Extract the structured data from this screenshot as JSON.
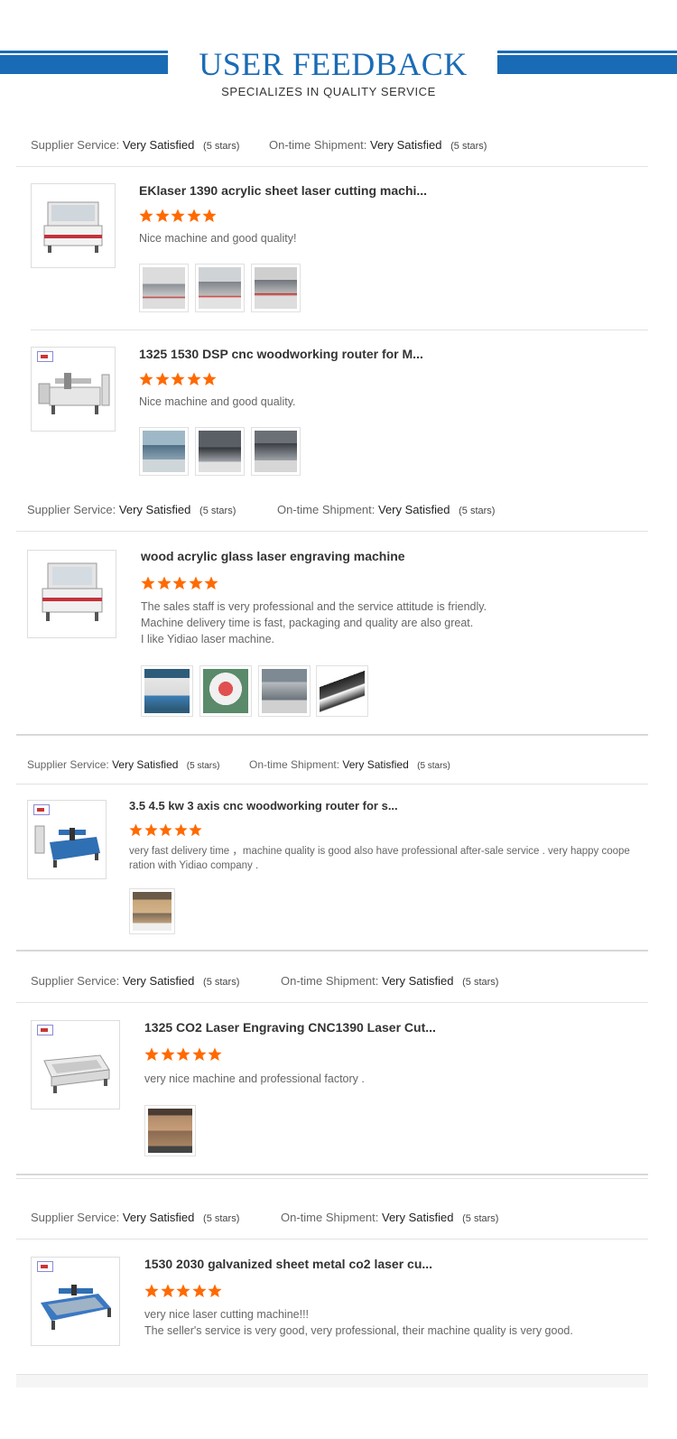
{
  "header": {
    "title": "USER FEEDBACK",
    "subtitle": "SPECIALIZES IN QUALITY SERVICE",
    "accent_color": "#1a6bb5"
  },
  "rating_labels": {
    "supplier": "Supplier Service:",
    "shipment": "On-time Shipment:",
    "value": "Very Satisfied",
    "stars": "(5 stars)"
  },
  "star_color": "#ff6a00",
  "star_rating": 5,
  "reviews": [
    {
      "title": "EKlaser 1390 acrylic sheet laser cutting machi...",
      "comment_lines": [
        "Nice machine and good quality!"
      ],
      "photo_count": 3
    },
    {
      "title": "1325 1530 DSP cnc woodworking router for M...",
      "comment_lines": [
        "Nice machine and good quality."
      ],
      "photo_count": 3
    },
    {
      "title": "wood acrylic glass laser engraving machine",
      "comment_lines": [
        "The sales staff is very professional and the service attitude is friendly.",
        "Machine delivery time is fast, packaging and quality are also great.",
        "I like Yidiao laser machine."
      ],
      "photo_count": 4
    },
    {
      "title": "3.5 4.5 kw 3 axis cnc woodworking router for s...",
      "comment_lines": [
        "very fast delivery time ，machine quality is good also have professional after-sale service . very happy coope",
        "ration with Yidiao company ."
      ],
      "photo_count": 1
    },
    {
      "title": "1325 CO2 Laser Engraving CNC1390 Laser Cut...",
      "comment_lines": [
        "very nice machine and professional factory ."
      ],
      "photo_count": 1
    },
    {
      "title": "1530 2030 galvanized sheet metal co2 laser cu...",
      "comment_lines": [
        "very nice laser cutting machine!!!",
        "The seller's service is very good, very professional, their machine quality is very good."
      ],
      "photo_count": 0
    }
  ]
}
